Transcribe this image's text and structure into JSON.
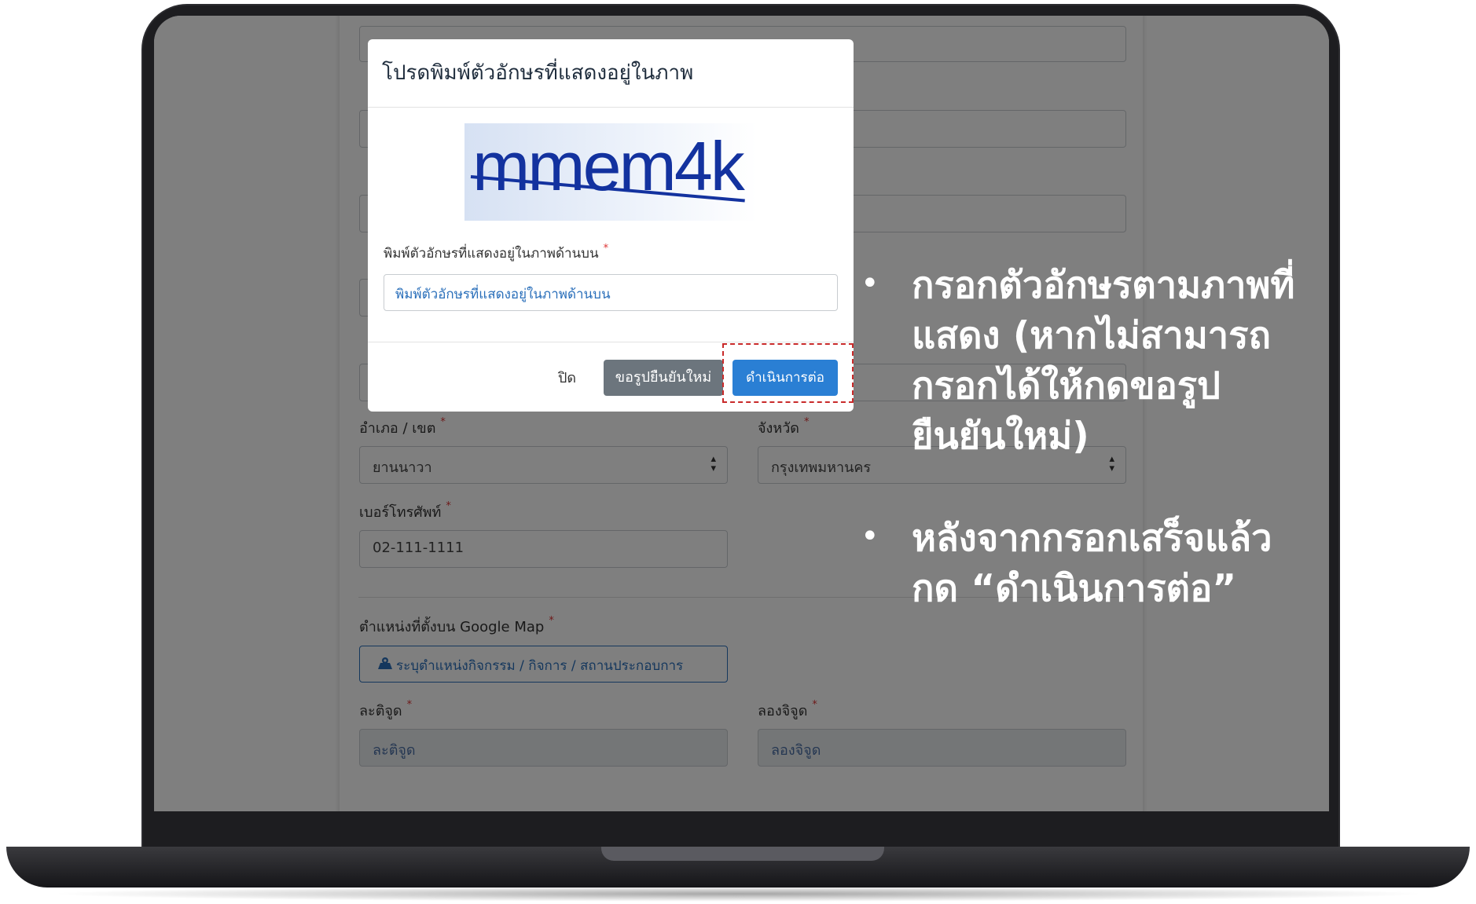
{
  "form": {
    "district_label": "อำเภอ / เขต",
    "district_value": "ยานนาวา",
    "province_label": "จังหวัด",
    "province_value": "กรุงเทพมหานคร",
    "phone_label": "เบอร์โทรศัพท์",
    "phone_value": "02-111-1111",
    "map_label": "ตำแหน่งที่ตั้งบน Google Map",
    "map_button": "ระบุตำแหน่งกิจกรรม / กิจการ / สถานประกอบการ",
    "lat_label": "ละติจูด",
    "lat_placeholder": "ละติจูด",
    "lng_label": "ลองจิจูด",
    "lng_placeholder": "ลองจิจูด",
    "required_mark": "*"
  },
  "modal": {
    "title": "โปรดพิมพ์ตัวอักษรที่แสดงอยู่ในภาพ",
    "captcha_text": "mmem4k",
    "input_label": "พิมพ์ตัวอักษรที่แสดงอยู่ในภาพด้านบน",
    "input_placeholder": "พิมพ์ตัวอักษรที่แสดงอยู่ในภาพด้านบน",
    "close_button": "ปิด",
    "refresh_button": "ขอรูปยืนยันใหม่",
    "continue_button": "ดำเนินการต่อ"
  },
  "instructions": {
    "bullet_symbol": "•",
    "items": [
      {
        "line1": "กรอกตัวอักษรตามภาพที่",
        "line2": "แสดง (หากไม่สามารถ",
        "line3": "กรอกได้ให้กดขอรูป",
        "line4": "ยืนยันใหม่)"
      },
      {
        "line1": "หลังจากกรอกเสร็จแล้ว",
        "line2": "กด “ดำเนินการต่อ”"
      }
    ]
  },
  "colors": {
    "primary": "#2a7fd4",
    "secondary": "#6c757d",
    "highlight": "#c92a2a"
  }
}
